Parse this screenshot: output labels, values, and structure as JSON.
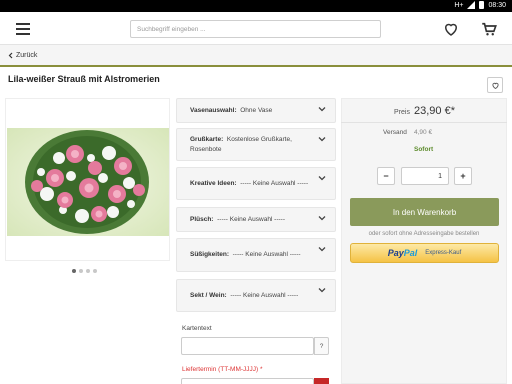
{
  "status_bar": {
    "network": "H+",
    "time": "08:30"
  },
  "header": {
    "search_placeholder": "Suchbegriff eingeben ..."
  },
  "breadcrumb": {
    "back_label": "Zurück"
  },
  "product": {
    "title": "Lila-weißer Strauß mit Alstromerien",
    "gallery_dots": 4,
    "active_dot": 1
  },
  "options": [
    {
      "label": "Vasenauswahl:",
      "value": "Ohne Vase"
    },
    {
      "label": "Grußkarte:",
      "value": "Kostenlose Grußkarte, Rosenbote"
    },
    {
      "label": "Kreative Ideen:",
      "value": "----- Keine Auswahl -----"
    },
    {
      "label": "Plüsch:",
      "value": "----- Keine Auswahl -----"
    },
    {
      "label": "Süßigkeiten:",
      "value": "----- Keine Auswahl -----"
    },
    {
      "label": "Sekt / Wein:",
      "value": "----- Keine Auswahl -----"
    }
  ],
  "form": {
    "card_text_label": "Kartentext",
    "card_text_help": "?",
    "delivery_date_label": "Liefertermin (TT-MM-JJJJ) *"
  },
  "buy_box": {
    "price_label": "Preis",
    "price": "23,90 €*",
    "shipping_label": "Versand",
    "shipping_value": "4,90 €",
    "availability": "Sofort",
    "quantity": "1",
    "minus": "−",
    "plus": "+",
    "cart_button": "In den Warenkorb",
    "alt_checkout_text": "oder sofort ohne Adresseingabe bestellen",
    "paypal_logo_a": "Pay",
    "paypal_logo_b": "Pal",
    "paypal_express": "Express-Kauf"
  },
  "colors": {
    "accent_olive": "#8a9a5b",
    "availability_green": "#5b8a2a",
    "required_red": "#d33333",
    "paypal_yellow": "#f5c346"
  },
  "icons": [
    "menu-icon",
    "heart-icon",
    "cart-icon",
    "chevron-left-icon",
    "chevron-down-icon",
    "question-icon"
  ]
}
